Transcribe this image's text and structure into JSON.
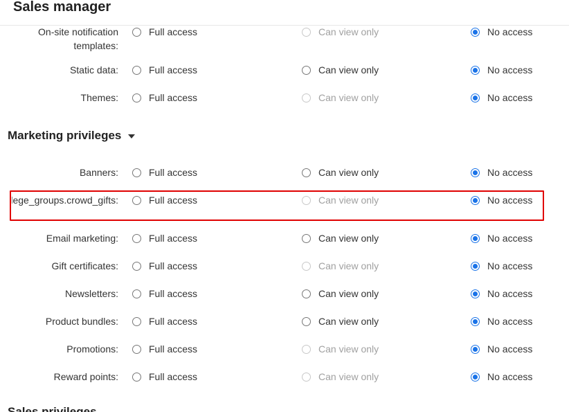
{
  "header": {
    "title": "Sales manager"
  },
  "options": {
    "full": "Full access",
    "view": "Can view only",
    "none": "No access"
  },
  "top_rows": [
    {
      "label": "On-site notification templates:",
      "selected": "none",
      "view_disabled": true
    },
    {
      "label": "Static data:",
      "selected": "none",
      "view_disabled": false
    },
    {
      "label": "Themes:",
      "selected": "none",
      "view_disabled": true
    }
  ],
  "marketing": {
    "title": "Marketing privileges",
    "rows": [
      {
        "label": "Banners:",
        "selected": "none",
        "view_disabled": false
      },
      {
        "label": "_privilege_groups.crowd_gifts:",
        "selected": "none",
        "view_disabled": true
      },
      {
        "label": "Email marketing:",
        "selected": "none",
        "view_disabled": false
      },
      {
        "label": "Gift certificates:",
        "selected": "none",
        "view_disabled": true
      },
      {
        "label": "Newsletters:",
        "selected": "none",
        "view_disabled": false
      },
      {
        "label": "Product bundles:",
        "selected": "none",
        "view_disabled": false
      },
      {
        "label": "Promotions:",
        "selected": "none",
        "view_disabled": true
      },
      {
        "label": "Reward points:",
        "selected": "none",
        "view_disabled": true
      }
    ]
  },
  "next_section": {
    "title": "Sales privileges"
  }
}
